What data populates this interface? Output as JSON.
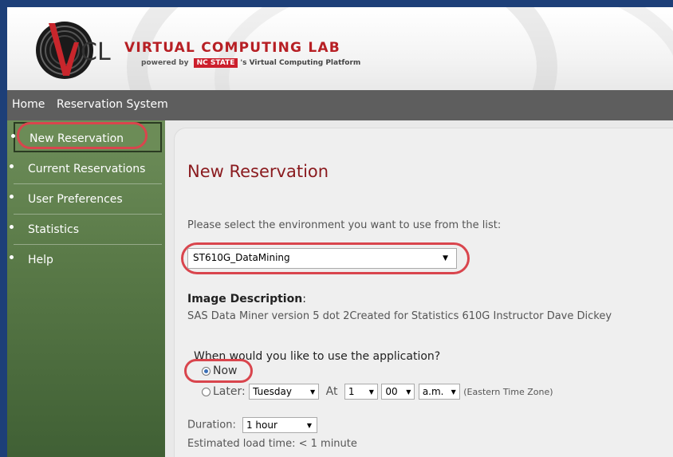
{
  "brand": {
    "logo_text": "CL",
    "title": "VIRTUAL COMPUTING LAB",
    "subtitle_prefix": "powered by",
    "subtitle_badge": "NC STATE",
    "subtitle_suffix": "'s Virtual Computing Platform"
  },
  "nav": {
    "home": "Home",
    "reservation_system": "Reservation System"
  },
  "sidebar": {
    "items": [
      {
        "label": "New Reservation"
      },
      {
        "label": "Current Reservations"
      },
      {
        "label": "User Preferences"
      },
      {
        "label": "Statistics"
      },
      {
        "label": "Help"
      }
    ]
  },
  "main": {
    "title": "New Reservation",
    "prompt": "Please select the environment you want to use from the list:",
    "environment": "ST610G_DataMining",
    "description_label": "Image Description",
    "description_colon": ":",
    "description_text": "SAS Data Miner version 5 dot 2Created for Statistics 610G Instructor Dave Dickey",
    "when_question": "When would you like to use the application?",
    "now_label": "Now",
    "later_label": "Later:",
    "later_day": "Tuesday",
    "at_label": "At",
    "later_hour": "1",
    "later_minute": "00",
    "later_ampm": "a.m.",
    "timezone": "(Eastern Time Zone)",
    "duration_label": "Duration:",
    "duration_value": "1 hour",
    "load_time": "Estimated load time: < 1 minute"
  },
  "colors": {
    "frame_blue": "#1d3f78",
    "brand_red": "#b71f24",
    "title_red": "#8a1a1e",
    "annotation_circle": "#d9454d",
    "sidebar_green": "#5a7a48",
    "navbar_gray": "#5e5e5e"
  }
}
